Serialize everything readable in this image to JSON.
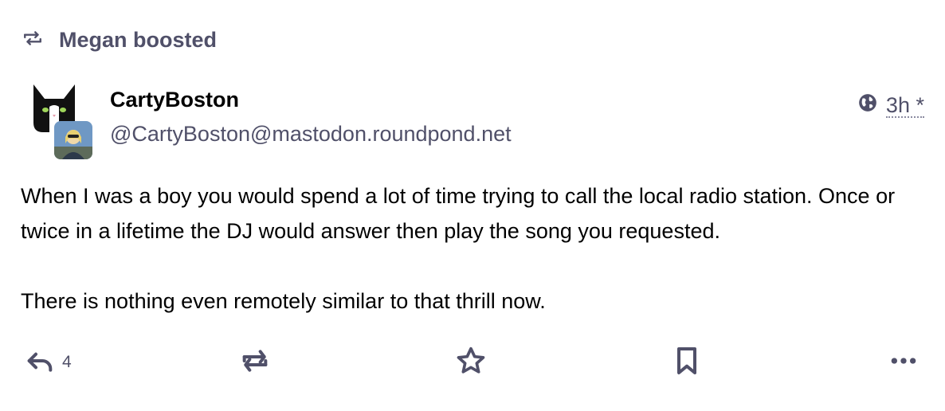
{
  "boost": {
    "icon": "boost-icon",
    "text": "Megan boosted"
  },
  "account": {
    "display_name": "CartyBoston",
    "handle": "@CartyBoston@mastodon.roundpond.net",
    "avatar_icon": "cat-avatar",
    "booster_avatar_icon": "booster-avatar"
  },
  "meta": {
    "visibility_icon": "globe-icon",
    "time": "3h",
    "edited_mark": "*"
  },
  "content": {
    "paragraphs": [
      "When I was a boy you would spend a lot of time trying to call the local radio station. Once or twice in a lifetime the DJ would answer then play the song you requested.",
      "There is nothing even remotely similar to that thrill now."
    ]
  },
  "actions": {
    "reply_count": "4",
    "icons": [
      "reply-icon",
      "boost-icon",
      "star-icon",
      "bookmark-icon",
      "more-icon"
    ]
  },
  "colors": {
    "secondary_text": "#505069",
    "primary_text": "#000000"
  }
}
